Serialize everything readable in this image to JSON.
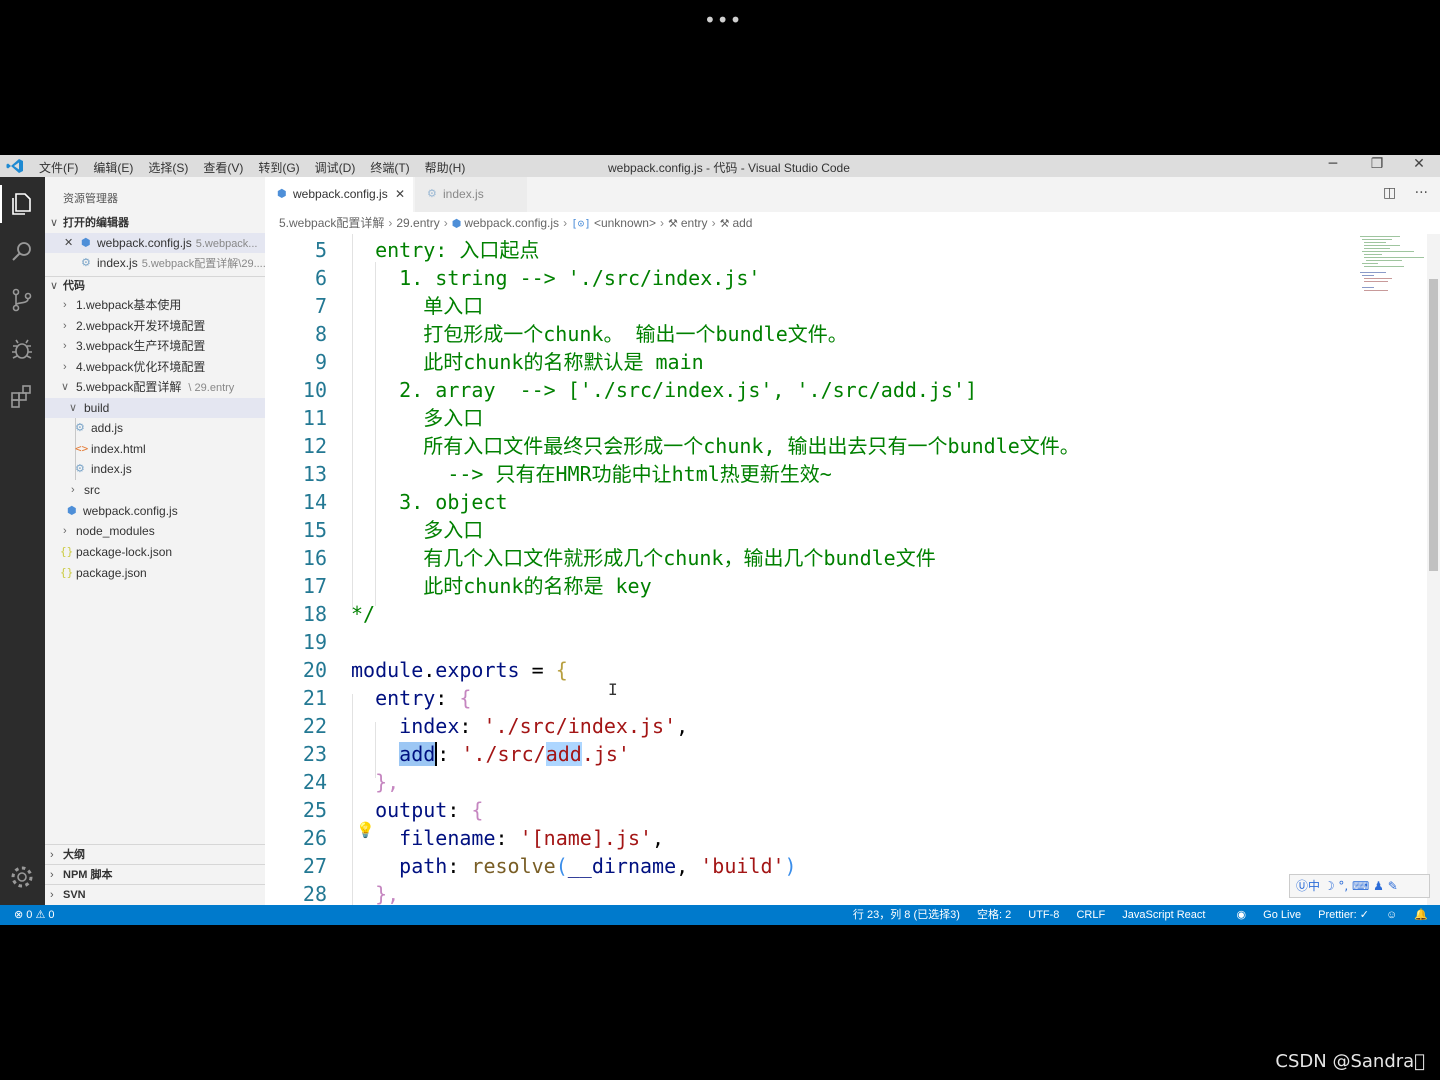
{
  "overlay": {
    "top_dots": "•••",
    "watermark": "CSDN @Sandra\u0000"
  },
  "titlebar": {
    "menu": [
      "文件(F)",
      "编辑(E)",
      "选择(S)",
      "查看(V)",
      "转到(G)",
      "调试(D)",
      "终端(T)",
      "帮助(H)"
    ],
    "title": "webpack.config.js - 代码 - Visual Studio Code",
    "minimize": "─",
    "restore": "❐",
    "close": "✕"
  },
  "activity_icons": [
    "explorer-icon",
    "search-icon",
    "source-control-icon",
    "debug-icon",
    "extensions-icon",
    "settings-gear-icon"
  ],
  "sidebar": {
    "title": "资源管理器",
    "open_editors_header": "打开的编辑器",
    "open_editors": [
      {
        "close": "✕",
        "name": "webpack.config.js",
        "desc": "5.webpack..."
      },
      {
        "name": "index.js",
        "desc": "5.webpack配置详解\\29...."
      }
    ],
    "workspace_header": "代码",
    "tree": [
      {
        "name": "1.webpack基本使用"
      },
      {
        "name": "2.webpack开发环境配置"
      },
      {
        "name": "3.webpack生产环境配置"
      },
      {
        "name": "4.webpack优化环境配置"
      },
      {
        "name": "5.webpack配置详解",
        "desc": "29.entry"
      },
      {
        "name": "build"
      },
      {
        "name": "add.js"
      },
      {
        "name": "index.html"
      },
      {
        "name": "index.js"
      },
      {
        "name": "src"
      },
      {
        "name": "webpack.config.js"
      },
      {
        "name": "node_modules"
      },
      {
        "name": "package-lock.json"
      },
      {
        "name": "package.json"
      }
    ],
    "bottom_sections": [
      "大纲",
      "NPM 脚本",
      "SVN"
    ]
  },
  "tabs": [
    {
      "label": "webpack.config.js",
      "close": "✕"
    },
    {
      "label": "index.js"
    }
  ],
  "tab_actions": {
    "split": "◫",
    "more": "···"
  },
  "breadcrumb": [
    "5.webpack配置详解",
    "29.entry",
    "webpack.config.js",
    "<unknown>",
    "entry",
    "add"
  ],
  "editor": {
    "line_numbers": [
      "5",
      "6",
      "7",
      "8",
      "9",
      "10",
      "11",
      "12",
      "13",
      "14",
      "15",
      "16",
      "17",
      "18",
      "19",
      "20",
      "21",
      "22",
      "23",
      "24",
      "25",
      "26",
      "27",
      "28"
    ],
    "comment_lines": [
      "  entry: 入口起点",
      "    1. string --> './src/index.js'",
      "      单入口",
      "      打包形成一个chunk。 输出一个bundle文件。",
      "      此时chunk的名称默认是 main",
      "    2. array  --> ['./src/index.js', './src/add.js']",
      "      多入口",
      "      所有入口文件最终只会形成一个chunk, 输出出去只有一个bundle文件。",
      "        --> 只有在HMR功能中让html热更新生效~",
      "    3. object",
      "      多入口",
      "      有几个入口文件就形成几个chunk，输出几个bundle文件",
      "      此时chunk的名称是 key",
      "*/"
    ],
    "code": {
      "module": "module",
      "dot": ".",
      "exports": "exports",
      "eq": " = ",
      "open_brace": "{",
      "entry_key": "  entry",
      "colon": ": ",
      "index_key": "    index",
      "index_val": "'./src/index.js'",
      "comma": ",",
      "add_key": "add",
      "add_val_1": "'./src/",
      "add_val_2": "add",
      "add_val_3": ".js'",
      "close_brace_comma": "},",
      "output_key": "  output",
      "filename_key": "    filename",
      "filename_val": "'[name].js'",
      "path_key": "    path",
      "resolve_fn": "resolve",
      "paren_open": "(",
      "dirname": "__dirname",
      "sep": ", ",
      "build_val": "'build'",
      "paren_close": ")",
      "line28": "  },"
    },
    "lightbulb": "💡",
    "ibeam": "I"
  },
  "ime_toolbar": "Ⓤ中 ☽ °, ⌨ ♟ ✎",
  "statusbar": {
    "problems": "⊗ 0 ⚠ 0",
    "position": "行 23，列 8 (已选择3)",
    "spaces": "空格: 2",
    "encoding": "UTF-8",
    "eol": "CRLF",
    "language": "JavaScript React",
    "golive": "Go Live",
    "prettier": "Prettier: ✓",
    "feedback": "☺",
    "bell": "🔔"
  }
}
